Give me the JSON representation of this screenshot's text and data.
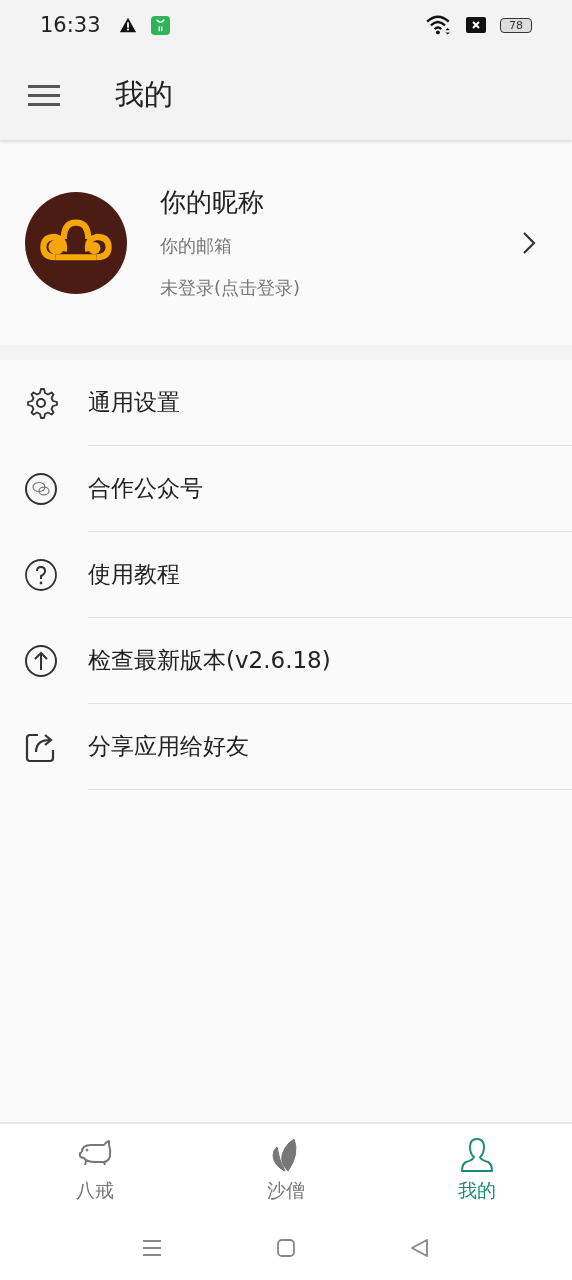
{
  "status_bar": {
    "time": "16:33",
    "battery": "78"
  },
  "app_bar": {
    "title": "我的"
  },
  "profile": {
    "nickname": "你的昵称",
    "email": "你的邮箱",
    "login_status": "未登录(点击登录)"
  },
  "menu": [
    {
      "kind": "settings",
      "label": "通用设置"
    },
    {
      "kind": "wechat",
      "label": "合作公众号"
    },
    {
      "kind": "help",
      "label": "使用教程"
    },
    {
      "kind": "update",
      "label": "检查最新版本(v2.6.18)"
    },
    {
      "kind": "share",
      "label": "分享应用给好友"
    }
  ],
  "bottom_nav": [
    {
      "kind": "pig",
      "label": "八戒",
      "selected": false
    },
    {
      "kind": "leaf",
      "label": "沙僧",
      "selected": false
    },
    {
      "kind": "person",
      "label": "我的",
      "selected": true
    }
  ]
}
